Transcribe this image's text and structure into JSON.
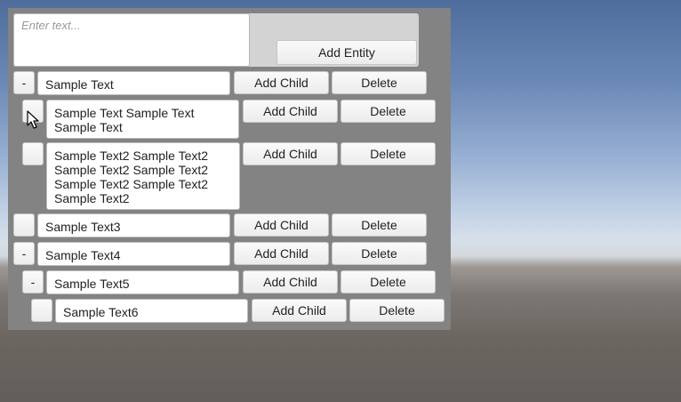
{
  "header": {
    "text_placeholder": "Enter text...",
    "add_entity_label": "Add Entity"
  },
  "rows": [
    {
      "toggle": "-",
      "text": "Sample Text",
      "add_child": "Add Child",
      "delete": "Delete"
    },
    {
      "toggle": "",
      "text": "Sample Text Sample Text Sample Text",
      "add_child": "Add Child",
      "delete": "Delete"
    },
    {
      "toggle": "",
      "text": "Sample Text2 Sample Text2 Sample Text2 Sample Text2 Sample Text2 Sample Text2 Sample Text2",
      "add_child": "Add Child",
      "delete": "Delete"
    },
    {
      "toggle": "",
      "text": "Sample Text3",
      "add_child": "Add Child",
      "delete": "Delete"
    },
    {
      "toggle": "-",
      "text": "Sample Text4",
      "add_child": "Add Child",
      "delete": "Delete"
    },
    {
      "toggle": "-",
      "text": "Sample Text5",
      "add_child": "Add Child",
      "delete": "Delete"
    },
    {
      "toggle": "",
      "text": "Sample Text6",
      "add_child": "Add Child",
      "delete": "Delete"
    }
  ]
}
